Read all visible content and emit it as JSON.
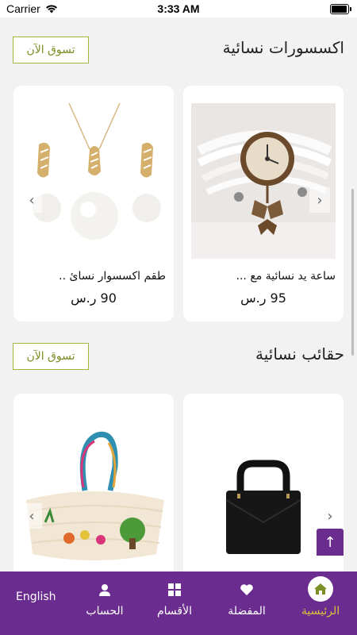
{
  "status": {
    "carrier": "Carrier",
    "time": "3:33 AM"
  },
  "sections": [
    {
      "title": "اكسسورات نسائية",
      "shop_label": "تسوق الآن",
      "products": [
        {
          "name": "ساعة يد نسائية مع ...",
          "price": "95 ر.س"
        },
        {
          "name": "طقم اكسسوار نسائ ..",
          "price": "90 ر.س"
        }
      ]
    },
    {
      "title": "حقائب نسائية",
      "shop_label": "تسوق الآن",
      "products": [
        {
          "name": "",
          "price": ""
        },
        {
          "name": "",
          "price": ""
        }
      ]
    }
  ],
  "bottom_nav": {
    "home": "الرئيسية",
    "favorites": "المفضلة",
    "categories": "الأقسام",
    "account": "الحساب",
    "language": "English"
  },
  "colors": {
    "brand": "#6b2c8f",
    "accent": "#9fb63a",
    "active": "#d7c23a"
  }
}
